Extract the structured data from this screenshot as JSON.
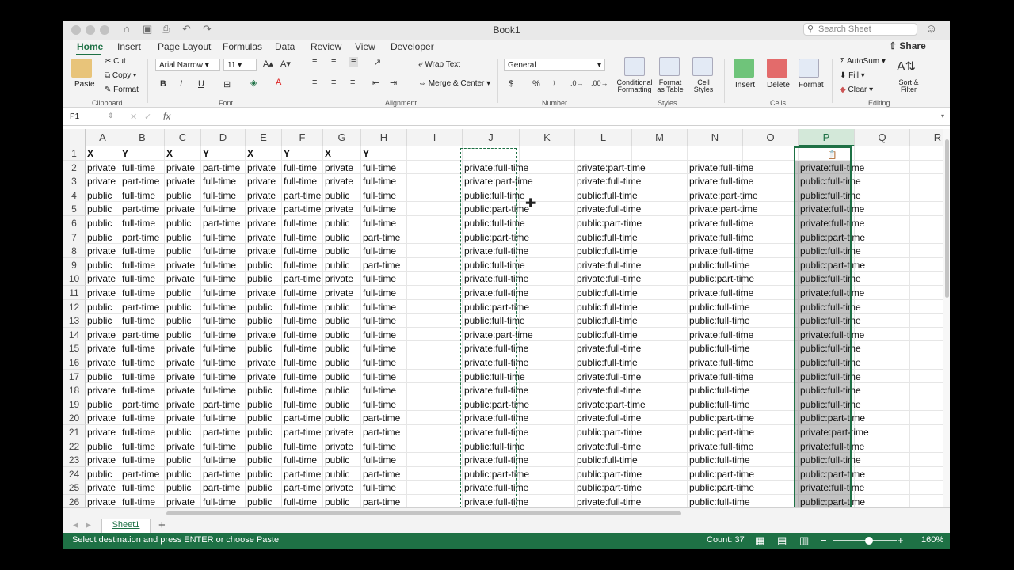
{
  "window": {
    "title": "Book1",
    "search_placeholder": "Search Sheet"
  },
  "tabs": [
    "Home",
    "Insert",
    "Page Layout",
    "Formulas",
    "Data",
    "Review",
    "View",
    "Developer"
  ],
  "share_label": "Share",
  "ribbon": {
    "clipboard": {
      "paste": "Paste",
      "cut": "Cut",
      "copy": "Copy",
      "format": "Format",
      "group": "Clipboard"
    },
    "font": {
      "name": "Arial Narrow",
      "size": "11",
      "bold": "B",
      "italic": "I",
      "underline": "U",
      "group": "Font"
    },
    "alignment": {
      "wrap_text": "Wrap Text",
      "merge_center": "Merge & Center",
      "group": "Alignment"
    },
    "number": {
      "format": "General",
      "currency": "$",
      "percent": "%",
      "group": "Number"
    },
    "styles": {
      "conditional": "Conditional Formatting",
      "format_table": "Format as Table",
      "cell_styles": "Cell Styles",
      "group": "Styles"
    },
    "cells": {
      "insert": "Insert",
      "delete": "Delete",
      "format": "Format",
      "group": "Cells"
    },
    "editing": {
      "autosum": "AutoSum",
      "fill": "Fill",
      "clear": "Clear",
      "sort_filter": "Sort & Filter",
      "group": "Editing"
    }
  },
  "formula_bar": {
    "name_box": "P1",
    "fx": "fx",
    "value": ""
  },
  "columns": [
    "A",
    "B",
    "C",
    "D",
    "E",
    "F",
    "G",
    "H",
    "I",
    "J",
    "K",
    "L",
    "M",
    "N",
    "O",
    "P",
    "Q",
    "R"
  ],
  "selected_column": "P",
  "rows": [
    [
      "X",
      "Y",
      "X",
      "Y",
      "X",
      "Y",
      "X",
      "Y",
      "",
      "",
      "",
      "",
      "",
      "",
      ""
    ],
    [
      "private",
      "full-time",
      "private",
      "part-time",
      "private",
      "full-time",
      "private",
      "full-time",
      "",
      "private:full-time",
      "",
      "private:part-time",
      "",
      "private:full-time",
      "private:full-time"
    ],
    [
      "private",
      "part-time",
      "private",
      "full-time",
      "private",
      "full-time",
      "private",
      "full-time",
      "",
      "private:part-time",
      "",
      "private:full-time",
      "",
      "private:full-time",
      "public:full-time"
    ],
    [
      "public",
      "full-time",
      "public",
      "full-time",
      "private",
      "part-time",
      "public",
      "full-time",
      "",
      "public:full-time",
      "",
      "public:full-time",
      "",
      "private:part-time",
      "public:full-time"
    ],
    [
      "public",
      "part-time",
      "private",
      "full-time",
      "private",
      "part-time",
      "private",
      "full-time",
      "",
      "public:part-time",
      "",
      "private:full-time",
      "",
      "private:part-time",
      "private:full-time"
    ],
    [
      "public",
      "full-time",
      "public",
      "part-time",
      "private",
      "full-time",
      "public",
      "full-time",
      "",
      "public:full-time",
      "",
      "public:part-time",
      "",
      "private:full-time",
      "private:full-time"
    ],
    [
      "public",
      "part-time",
      "public",
      "full-time",
      "private",
      "full-time",
      "public",
      "part-time",
      "",
      "public:part-time",
      "",
      "public:full-time",
      "",
      "private:full-time",
      "public:part-time"
    ],
    [
      "private",
      "full-time",
      "public",
      "full-time",
      "private",
      "full-time",
      "public",
      "full-time",
      "",
      "private:full-time",
      "",
      "public:full-time",
      "",
      "private:full-time",
      "public:full-time"
    ],
    [
      "public",
      "full-time",
      "private",
      "full-time",
      "public",
      "full-time",
      "public",
      "part-time",
      "",
      "public:full-time",
      "",
      "private:full-time",
      "",
      "public:full-time",
      "public:part-time"
    ],
    [
      "private",
      "full-time",
      "private",
      "full-time",
      "public",
      "part-time",
      "private",
      "full-time",
      "",
      "private:full-time",
      "",
      "private:full-time",
      "",
      "public:part-time",
      "public:full-time"
    ],
    [
      "private",
      "full-time",
      "public",
      "full-time",
      "private",
      "full-time",
      "private",
      "full-time",
      "",
      "private:full-time",
      "",
      "public:full-time",
      "",
      "private:full-time",
      "private:full-time"
    ],
    [
      "public",
      "part-time",
      "public",
      "full-time",
      "public",
      "full-time",
      "public",
      "full-time",
      "",
      "public:part-time",
      "",
      "public:full-time",
      "",
      "public:full-time",
      "public:full-time"
    ],
    [
      "public",
      "full-time",
      "public",
      "full-time",
      "public",
      "full-time",
      "public",
      "full-time",
      "",
      "public:full-time",
      "",
      "public:full-time",
      "",
      "public:full-time",
      "public:full-time"
    ],
    [
      "private",
      "part-time",
      "public",
      "full-time",
      "private",
      "full-time",
      "public",
      "full-time",
      "",
      "private:part-time",
      "",
      "public:full-time",
      "",
      "private:full-time",
      "private:full-time"
    ],
    [
      "private",
      "full-time",
      "private",
      "full-time",
      "public",
      "full-time",
      "public",
      "full-time",
      "",
      "private:full-time",
      "",
      "private:full-time",
      "",
      "public:full-time",
      "public:full-time"
    ],
    [
      "private",
      "full-time",
      "private",
      "full-time",
      "private",
      "full-time",
      "public",
      "full-time",
      "",
      "private:full-time",
      "",
      "public:full-time",
      "",
      "private:full-time",
      "public:full-time"
    ],
    [
      "public",
      "full-time",
      "private",
      "full-time",
      "private",
      "full-time",
      "public",
      "full-time",
      "",
      "public:full-time",
      "",
      "private:full-time",
      "",
      "private:full-time",
      "public:full-time"
    ],
    [
      "private",
      "full-time",
      "private",
      "full-time",
      "public",
      "full-time",
      "public",
      "full-time",
      "",
      "private:full-time",
      "",
      "private:full-time",
      "",
      "public:full-time",
      "public:full-time"
    ],
    [
      "public",
      "part-time",
      "private",
      "part-time",
      "public",
      "full-time",
      "public",
      "full-time",
      "",
      "public:part-time",
      "",
      "private:part-time",
      "",
      "public:full-time",
      "public:full-time"
    ],
    [
      "private",
      "full-time",
      "private",
      "full-time",
      "public",
      "part-time",
      "public",
      "part-time",
      "",
      "private:full-time",
      "",
      "private:full-time",
      "",
      "public:part-time",
      "public:part-time"
    ],
    [
      "private",
      "full-time",
      "public",
      "part-time",
      "public",
      "part-time",
      "private",
      "part-time",
      "",
      "private:full-time",
      "",
      "public:part-time",
      "",
      "public:part-time",
      "private:part-time"
    ],
    [
      "public",
      "full-time",
      "private",
      "full-time",
      "public",
      "full-time",
      "private",
      "full-time",
      "",
      "public:full-time",
      "",
      "private:full-time",
      "",
      "private:full-time",
      "private:full-time"
    ],
    [
      "private",
      "full-time",
      "public",
      "full-time",
      "public",
      "full-time",
      "public",
      "full-time",
      "",
      "private:full-time",
      "",
      "public:full-time",
      "",
      "public:full-time",
      "public:full-time"
    ],
    [
      "public",
      "part-time",
      "public",
      "part-time",
      "public",
      "part-time",
      "public",
      "part-time",
      "",
      "public:part-time",
      "",
      "public:part-time",
      "",
      "public:part-time",
      "public:part-time"
    ],
    [
      "private",
      "full-time",
      "public",
      "part-time",
      "public",
      "part-time",
      "private",
      "full-time",
      "",
      "private:full-time",
      "",
      "public:part-time",
      "",
      "public:part-time",
      "private:full-time"
    ],
    [
      "private",
      "full-time",
      "private",
      "full-time",
      "public",
      "full-time",
      "public",
      "part-time",
      "",
      "private:full-time",
      "",
      "private:full-time",
      "",
      "public:full-time",
      "public:part-time"
    ]
  ],
  "sheet_tab": "Sheet1",
  "status": {
    "message": "Select destination and press ENTER or choose Paste",
    "count": "Count: 37",
    "zoom": "160%"
  },
  "colors": {
    "accent": "#1e7145",
    "status_bar": "#1e7145"
  }
}
